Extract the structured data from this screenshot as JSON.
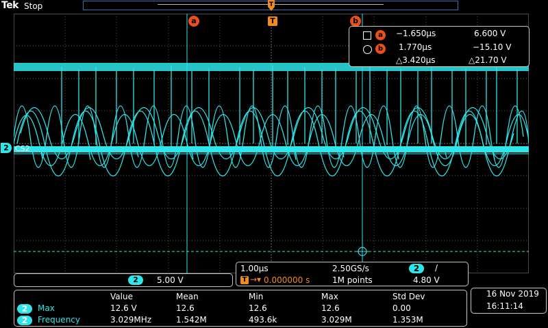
{
  "header": {
    "brand": "Tek",
    "run_state": "Stop"
  },
  "cursors": {
    "a": {
      "marker": "a"
    },
    "b": {
      "marker": "b"
    },
    "trigger": {
      "marker": "T"
    }
  },
  "channel": {
    "number": "2",
    "label": "CS2",
    "color": "#2ee6ea"
  },
  "cursor_readout": {
    "a": {
      "badge": "a",
      "time": "−1.650µs",
      "volt": "6.600 V"
    },
    "b": {
      "badge": "b",
      "time": "1.770µs",
      "volt": "−15.10 V"
    },
    "delta": {
      "time": "△3.420µs",
      "volt": "△21.70 V"
    }
  },
  "horizontal": {
    "timebase": "1.00µs",
    "sample_rate": "2.50GS/s",
    "trigger_channel": "2",
    "trigger_slope": "/",
    "trigger_position": "0.000000 s",
    "record_length": "1M points",
    "trigger_level": "4.80 V"
  },
  "vertical": {
    "channel": "2",
    "scale": "5.00 V"
  },
  "measurements": {
    "headers": [
      "Value",
      "Mean",
      "Min",
      "Max",
      "Std Dev"
    ],
    "rows": [
      {
        "channel": "2",
        "name": "Max",
        "values": [
          "12.6 V",
          "12.6",
          "12.6",
          "12.6",
          "0.00"
        ]
      },
      {
        "channel": "2",
        "name": "Frequency",
        "values": [
          "3.029MHz",
          "1.542M",
          "493.6k",
          "3.029M",
          "1.353M"
        ]
      }
    ]
  },
  "datetime": {
    "date": "16 Nov 2019",
    "time": "16:11:14"
  },
  "colors": {
    "trace": "#2ee6ea",
    "cursor": "#e8501a",
    "trigger": "#f08c1e",
    "grid": "#5a5a5a"
  }
}
